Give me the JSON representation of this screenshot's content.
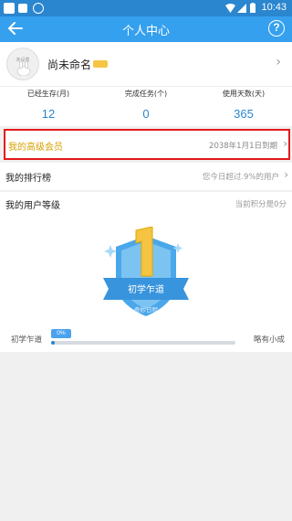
{
  "status_bar": {
    "time": "10:43"
  },
  "header": {
    "title": "个人中心",
    "help_label": "?"
  },
  "profile": {
    "name": "尚未命名",
    "avatar_text": "未设置"
  },
  "stats": [
    {
      "label": "已经生存(月)",
      "value": "12"
    },
    {
      "label": "完成任务(个)",
      "value": "0"
    },
    {
      "label": "使用天数(天)",
      "value": "365"
    }
  ],
  "vip": {
    "label": "我的高级会员",
    "expiry": "2038年1月1日到期"
  },
  "ranking": {
    "label": "我的排行榜",
    "summary": "您今日超过.9%的用户"
  },
  "level": {
    "label": "我的用户等级",
    "points": "当前积分是0分",
    "current_level": "初学乍道",
    "next_level": "略有小成",
    "progress_label": "0%",
    "progress": 0.02,
    "badge_number": "1",
    "badge_title": "初学乍道",
    "badge_subtitle": "奇妙日程"
  },
  "colors": {
    "primary": "#35a0ee",
    "accent": "#2a86cf",
    "vip_text": "#d6a100",
    "highlight_border": "#e31a1a"
  }
}
